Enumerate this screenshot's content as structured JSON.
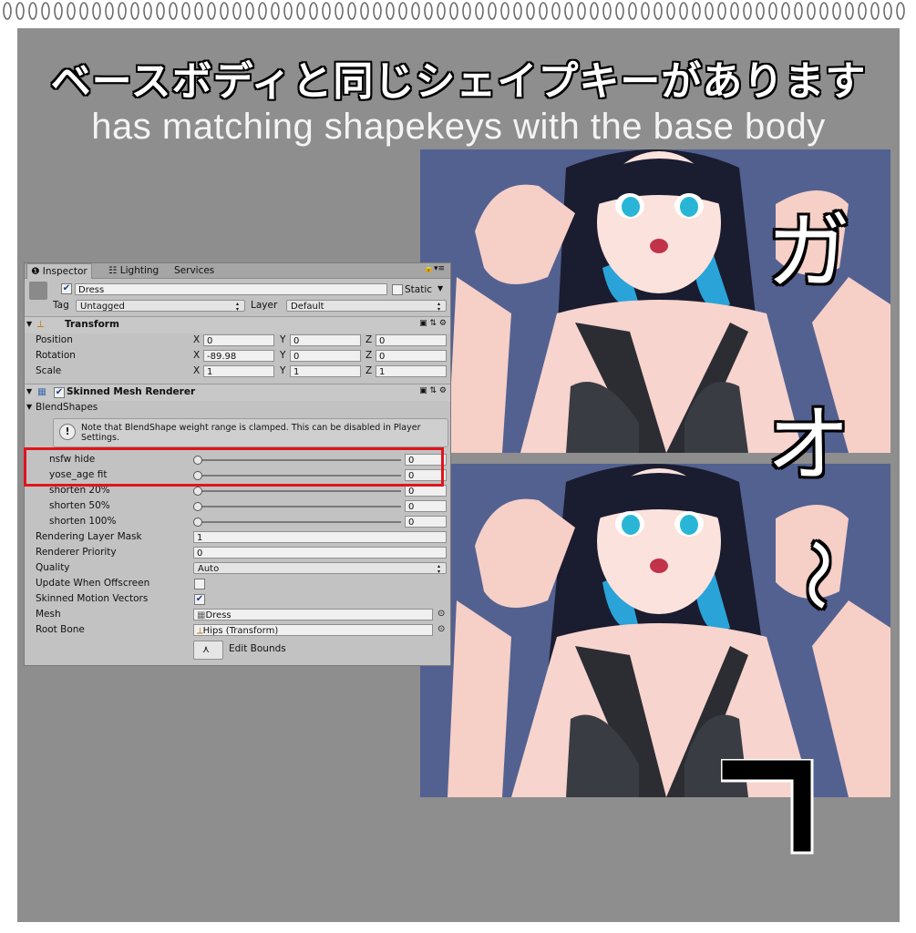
{
  "header": {
    "title_jp": "ベースボディと同じシェイプキーがあります",
    "title_en": "has matching shapekeys with the base body"
  },
  "overlay": {
    "gao_chars": [
      "ガ",
      "オ",
      "〜"
    ]
  },
  "inspector": {
    "tabs": [
      {
        "label": "Inspector",
        "icon": "info-icon",
        "active": true
      },
      {
        "label": "Lighting",
        "icon": "lighting-icon",
        "active": false
      },
      {
        "label": "Services",
        "active": false
      }
    ],
    "object": {
      "name": "Dress",
      "active": true,
      "static_label": "Static",
      "static": false,
      "tag_label": "Tag",
      "tag": "Untagged",
      "layer_label": "Layer",
      "layer": "Default"
    },
    "transform": {
      "title": "Transform",
      "rows": [
        {
          "label": "Position",
          "x": "0",
          "y": "0",
          "z": "0"
        },
        {
          "label": "Rotation",
          "x": "-89.98",
          "y": "0",
          "z": "0"
        },
        {
          "label": "Scale",
          "x": "1",
          "y": "1",
          "z": "1"
        }
      ],
      "axis_labels": {
        "x": "X",
        "y": "Y",
        "z": "Z"
      }
    },
    "skinned_mesh": {
      "title": "Skinned Mesh Renderer",
      "blendshapes_label": "BlendShapes",
      "note": "Note that BlendShape weight range is clamped. This can be disabled in Player Settings.",
      "blendshapes": [
        {
          "name": "nsfw hide",
          "value": "0",
          "weight": 0
        },
        {
          "name": "yose_age fit",
          "value": "0",
          "weight": 0
        },
        {
          "name": "shorten 20%",
          "value": "0",
          "weight": 0
        },
        {
          "name": "shorten 50%",
          "value": "0",
          "weight": 0
        },
        {
          "name": "shorten 100%",
          "value": "0",
          "weight": 0
        }
      ],
      "rendering_layer_mask": {
        "label": "Rendering Layer Mask",
        "value": "1"
      },
      "renderer_priority": {
        "label": "Renderer Priority",
        "value": "0"
      },
      "quality": {
        "label": "Quality",
        "value": "Auto"
      },
      "update_when_offscreen": {
        "label": "Update When Offscreen",
        "checked": false
      },
      "skinned_motion_vectors": {
        "label": "Skinned Motion Vectors",
        "checked": true
      },
      "mesh": {
        "label": "Mesh",
        "value": "Dress"
      },
      "root_bone": {
        "label": "Root Bone",
        "value": "Hips (Transform)"
      },
      "edit_bounds_label": "Edit Bounds"
    }
  },
  "colors": {
    "panel_bg": "#8e8e8e",
    "inspector_bg": "#c2c2c2",
    "highlight_red": "#e0141c",
    "art_bg": "#536191"
  }
}
